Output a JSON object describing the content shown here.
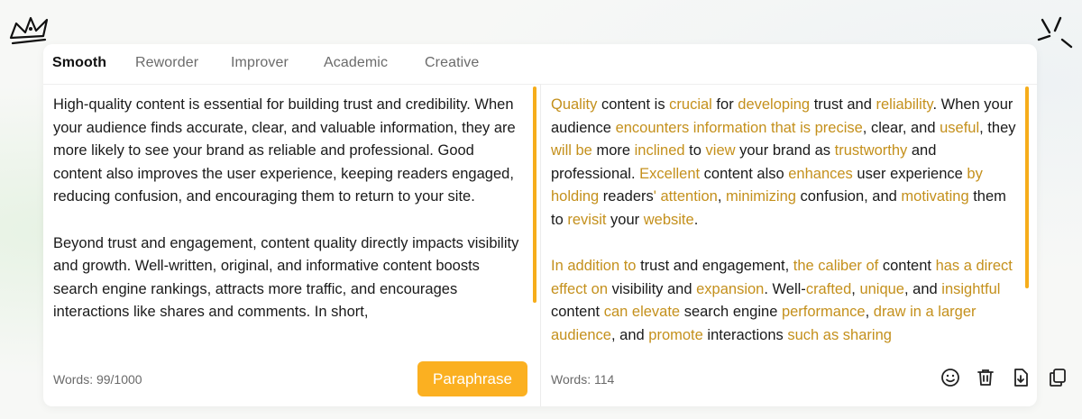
{
  "tabs": [
    {
      "label": "Smooth",
      "active": true
    },
    {
      "label": "Reworder",
      "active": false
    },
    {
      "label": "Improver",
      "active": false
    },
    {
      "label": "Academic",
      "active": false
    },
    {
      "label": "Creative",
      "active": false
    }
  ],
  "input": {
    "paragraphs": [
      "High-quality content is essential for building trust and credibility. When your audience finds accurate, clear, and valuable information, they are more likely to see your brand as reliable and professional. Good content also improves the user experience, keeping readers engaged, reducing confusion, and encouraging them to return to your site.",
      "Beyond trust and engagement, content quality directly impacts visibility and growth. Well-written, original, and informative content boosts search engine rankings, attracts more traffic, and encourages interactions like shares and comments. In short,"
    ],
    "word_count": "Words: 99/1000",
    "button_label": "Paraphrase"
  },
  "output": {
    "paragraphs": [
      [
        {
          "t": "Quality",
          "hl": true
        },
        {
          "t": " content is ",
          "hl": false
        },
        {
          "t": "crucial",
          "hl": true
        },
        {
          "t": " for ",
          "hl": false
        },
        {
          "t": "developing",
          "hl": true
        },
        {
          "t": " trust and ",
          "hl": false
        },
        {
          "t": "reliability",
          "hl": true
        },
        {
          "t": ". When your audience ",
          "hl": false
        },
        {
          "t": "encounters information that is precise",
          "hl": true
        },
        {
          "t": ", clear, and ",
          "hl": false
        },
        {
          "t": "useful",
          "hl": true
        },
        {
          "t": ", they ",
          "hl": false
        },
        {
          "t": "will be",
          "hl": true
        },
        {
          "t": " more ",
          "hl": false
        },
        {
          "t": "inclined",
          "hl": true
        },
        {
          "t": " to ",
          "hl": false
        },
        {
          "t": "view",
          "hl": true
        },
        {
          "t": " your brand as ",
          "hl": false
        },
        {
          "t": "trustworthy",
          "hl": true
        },
        {
          "t": " and professional. ",
          "hl": false
        },
        {
          "t": "Excellent",
          "hl": true
        },
        {
          "t": " content also ",
          "hl": false
        },
        {
          "t": "enhances",
          "hl": true
        },
        {
          "t": " user experience ",
          "hl": false
        },
        {
          "t": "by holding",
          "hl": true
        },
        {
          "t": " readers",
          "hl": false
        },
        {
          "t": "'",
          "hl": true
        },
        {
          "t": " ",
          "hl": false
        },
        {
          "t": "attention",
          "hl": true
        },
        {
          "t": ", ",
          "hl": false
        },
        {
          "t": "minimizing",
          "hl": true
        },
        {
          "t": " confusion, and ",
          "hl": false
        },
        {
          "t": "motivating",
          "hl": true
        },
        {
          "t": " them to ",
          "hl": false
        },
        {
          "t": "revisit",
          "hl": true
        },
        {
          "t": " your ",
          "hl": false
        },
        {
          "t": "website",
          "hl": true
        },
        {
          "t": ".",
          "hl": false
        }
      ],
      [
        {
          "t": "In addition to",
          "hl": true
        },
        {
          "t": " trust and engagement, ",
          "hl": false
        },
        {
          "t": "the caliber of",
          "hl": true
        },
        {
          "t": " content ",
          "hl": false
        },
        {
          "t": "has a direct effect on",
          "hl": true
        },
        {
          "t": " visibility and ",
          "hl": false
        },
        {
          "t": "expansion",
          "hl": true
        },
        {
          "t": ". Well-",
          "hl": false
        },
        {
          "t": "crafted",
          "hl": true
        },
        {
          "t": ", ",
          "hl": false
        },
        {
          "t": "unique",
          "hl": true
        },
        {
          "t": ", and ",
          "hl": false
        },
        {
          "t": "insightful",
          "hl": true
        },
        {
          "t": " content ",
          "hl": false
        },
        {
          "t": "can elevate",
          "hl": true
        },
        {
          "t": " search engine ",
          "hl": false
        },
        {
          "t": "performance",
          "hl": true
        },
        {
          "t": ", ",
          "hl": false
        },
        {
          "t": "draw in a larger audience",
          "hl": true
        },
        {
          "t": ", and ",
          "hl": false
        },
        {
          "t": "promote",
          "hl": true
        },
        {
          "t": " interactions ",
          "hl": false
        },
        {
          "t": "such as sharing",
          "hl": true
        }
      ]
    ],
    "word_count": "Words: 114",
    "actions": [
      "smiley-icon",
      "trash-icon",
      "download-icon",
      "copy-icon"
    ]
  },
  "colors": {
    "accent": "#fbb021",
    "highlight": "#c4901c"
  }
}
